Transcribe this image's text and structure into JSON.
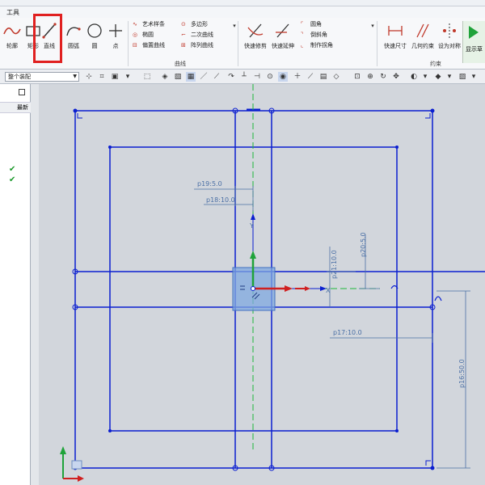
{
  "menu": {
    "tools": "工具"
  },
  "ribbon": {
    "tools": [
      {
        "label": "轮廓"
      },
      {
        "label": "矩形"
      },
      {
        "label": "直线"
      },
      {
        "label": "圆弧"
      },
      {
        "label": "圆"
      },
      {
        "label": "点"
      }
    ],
    "curve_group": {
      "col1": [
        "艺术样条",
        "椭圆",
        "偏置曲线"
      ],
      "col2": [
        "多边形",
        "二次曲线",
        "阵列曲线"
      ],
      "label": "曲线"
    },
    "edit_group": {
      "buttons": [
        "快速修剪",
        "快速延伸"
      ],
      "options": [
        "圆角",
        "倒斜角",
        "制作拐角"
      ]
    },
    "constraint_group": {
      "buttons": [
        "快速尺寸",
        "几何约束",
        "设为对称",
        "显示草"
      ],
      "label": "约束"
    }
  },
  "toolbar2": {
    "filter_select": "整个装配"
  },
  "left_panel": {
    "header": "最新"
  },
  "dimensions": {
    "p19": "p19:5.0",
    "p18": "p18:10.0",
    "p21": "p21:10.0",
    "p20": "p20:5.0",
    "p17": "p17:10.0",
    "p16": "p16:50.0"
  },
  "axes": {
    "x": "X",
    "y": "Y"
  },
  "colors": {
    "sketch": "#0b1fd0",
    "dim": "#4a6fa5",
    "highlight": "#e02020",
    "axis_green": "#1fb83a"
  }
}
